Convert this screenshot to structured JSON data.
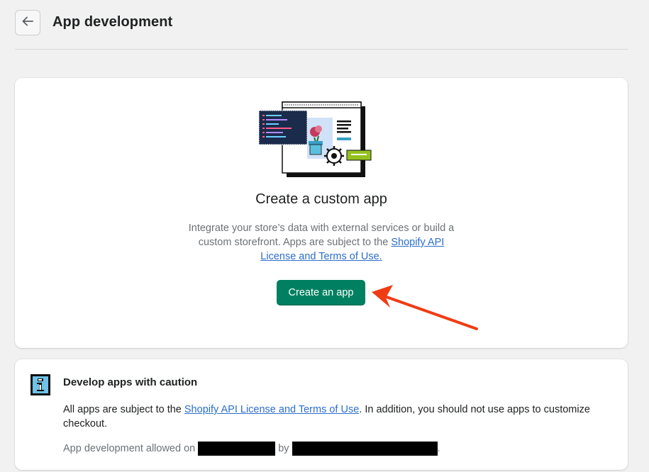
{
  "header": {
    "title": "App development",
    "back_icon": "arrow-left-icon"
  },
  "main_card": {
    "illustration": "custom-app-illustration",
    "title": "Create a custom app",
    "desc_prefix": "Integrate your store’s data with external services or build a custom storefront. Apps are subject to the ",
    "desc_link": "Shopify API License and Terms of Use.",
    "button_label": "Create an app",
    "button_color": "#008060"
  },
  "caution_card": {
    "icon": "info-icon",
    "title": "Develop apps with caution",
    "text_prefix": "All apps are subject to the ",
    "text_link": "Shopify API License and Terms of Use",
    "text_suffix": ". In addition, you should not use apps to customize checkout.",
    "allowed_prefix": "App development allowed on",
    "allowed_by": "by",
    "allowed_suffix": "."
  },
  "annotation": {
    "arrow_color": "#f03c14"
  },
  "colors": {
    "link": "#2c6ecb",
    "background": "#f1f1f1"
  }
}
